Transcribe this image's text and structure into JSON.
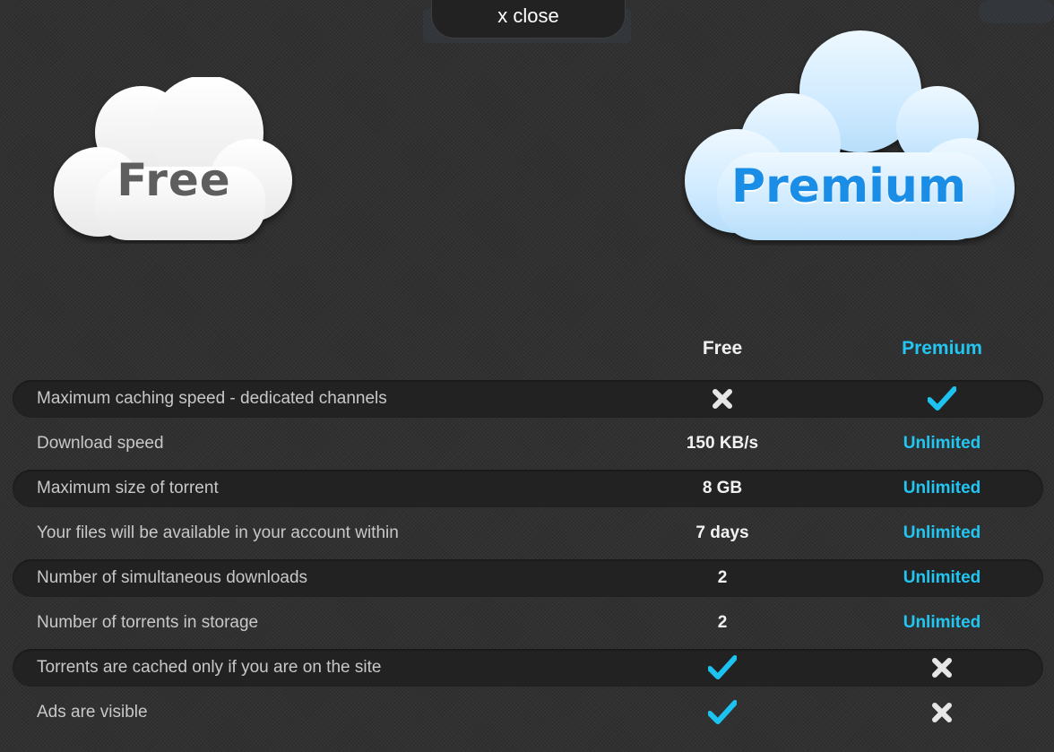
{
  "close_button": {
    "label": "x close"
  },
  "clouds": {
    "free": {
      "label": "Free"
    },
    "premium": {
      "label": "Premium"
    }
  },
  "columns": {
    "free": "Free",
    "premium": "Premium"
  },
  "colors": {
    "accent": "#21c6f2",
    "check": "#1cc3f0",
    "cross": "#e6e6e6",
    "background": "#313131"
  },
  "rows": [
    {
      "label": "Maximum caching speed - dedicated channels",
      "free": "cross-icon",
      "premium": "check-icon"
    },
    {
      "label": "Download speed",
      "free": "150 KB/s",
      "premium": "Unlimited"
    },
    {
      "label": "Maximum size of torrent",
      "free": "8 GB",
      "premium": "Unlimited"
    },
    {
      "label": "Your files will be available in your account within",
      "free": "7 days",
      "premium": "Unlimited"
    },
    {
      "label": "Number of simultaneous downloads",
      "free": "2",
      "premium": "Unlimited"
    },
    {
      "label": "Number of torrents in storage",
      "free": "2",
      "premium": "Unlimited"
    },
    {
      "label": "Torrents are cached only if you are on the site",
      "free": "check-icon",
      "premium": "cross-icon"
    },
    {
      "label": "Ads are visible",
      "free": "check-icon",
      "premium": "cross-icon"
    }
  ]
}
